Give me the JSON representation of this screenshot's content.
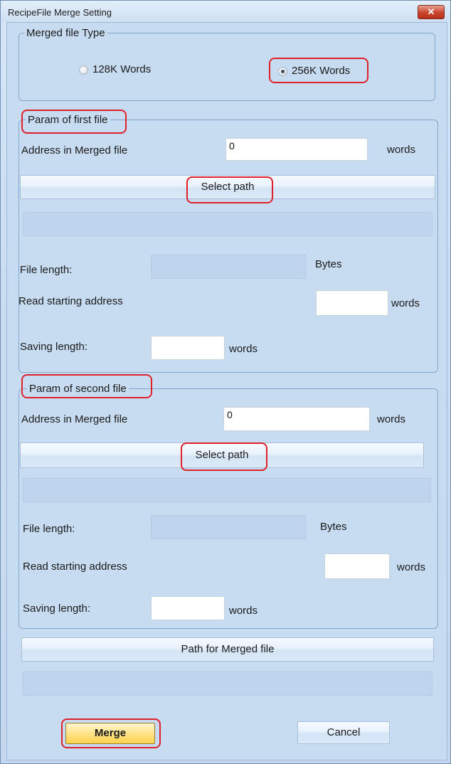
{
  "window": {
    "title": "RecipeFile Merge Setting",
    "close_glyph": "✕"
  },
  "file_type": {
    "legend": "Merged file Type",
    "options": [
      {
        "label": "128K Words",
        "selected": false
      },
      {
        "label": "256K Words",
        "selected": true
      }
    ]
  },
  "first": {
    "legend": "Param of first file",
    "address_label": "Address in Merged file",
    "address_value": "0",
    "address_unit": "words",
    "select_path": "Select path",
    "path_value": "",
    "file_length_label": "File length:",
    "file_length_value": "",
    "file_length_unit": "Bytes",
    "read_start_label": "Read starting address",
    "read_start_value": "",
    "read_start_unit": "words",
    "saving_label": "Saving length:",
    "saving_value": "",
    "saving_unit": "words"
  },
  "second": {
    "legend": "Param of second file",
    "address_label": "Address in Merged file",
    "address_value": "0",
    "address_unit": "words",
    "select_path": "Select path",
    "path_value": "",
    "file_length_label": "File length:",
    "file_length_value": "",
    "file_length_unit": "Bytes",
    "read_start_label": "Read starting address",
    "read_start_value": "",
    "read_start_unit": "words",
    "saving_label": "Saving length:",
    "saving_value": "",
    "saving_unit": "words"
  },
  "merged": {
    "path_button": "Path for Merged file",
    "path_value": ""
  },
  "actions": {
    "merge": "Merge",
    "cancel": "Cancel"
  },
  "colors": {
    "highlight": "#e0202a",
    "window_bg": "#c8dcf1"
  }
}
